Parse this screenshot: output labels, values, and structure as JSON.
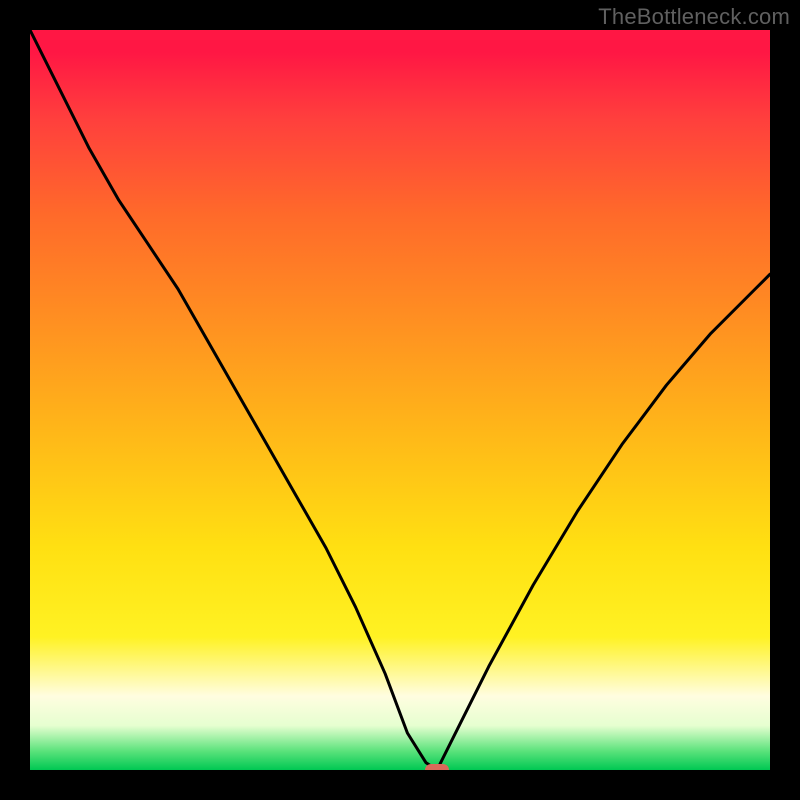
{
  "watermark": "TheBottleneck.com",
  "chart_data": {
    "type": "line",
    "title": "",
    "xlabel": "",
    "ylabel": "",
    "xlim": [
      0,
      100
    ],
    "ylim": [
      0,
      100
    ],
    "background": {
      "style": "vertical-gradient",
      "meaning": "bottleneck severity (red=high, green=low)",
      "stops": [
        {
          "pos": 0,
          "color": "#ff1744"
        },
        {
          "pos": 25,
          "color": "#ff6a2a"
        },
        {
          "pos": 55,
          "color": "#ffb918"
        },
        {
          "pos": 82,
          "color": "#fff223"
        },
        {
          "pos": 100,
          "color": "#00c853"
        }
      ]
    },
    "series": [
      {
        "name": "bottleneck-curve",
        "color": "#000000",
        "x": [
          0,
          4,
          8,
          12,
          16,
          20,
          24,
          28,
          32,
          36,
          40,
          44,
          48,
          51,
          53.5,
          55,
          58,
          62,
          68,
          74,
          80,
          86,
          92,
          98,
          100
        ],
        "y": [
          100,
          92,
          84,
          77,
          71,
          65,
          58,
          51,
          44,
          37,
          30,
          22,
          13,
          5,
          1,
          0,
          6,
          14,
          25,
          35,
          44,
          52,
          59,
          65,
          67
        ]
      }
    ],
    "marker": {
      "name": "optimal-point",
      "x": 55,
      "y": 0,
      "color": "#d96a5a",
      "shape": "pill"
    }
  }
}
